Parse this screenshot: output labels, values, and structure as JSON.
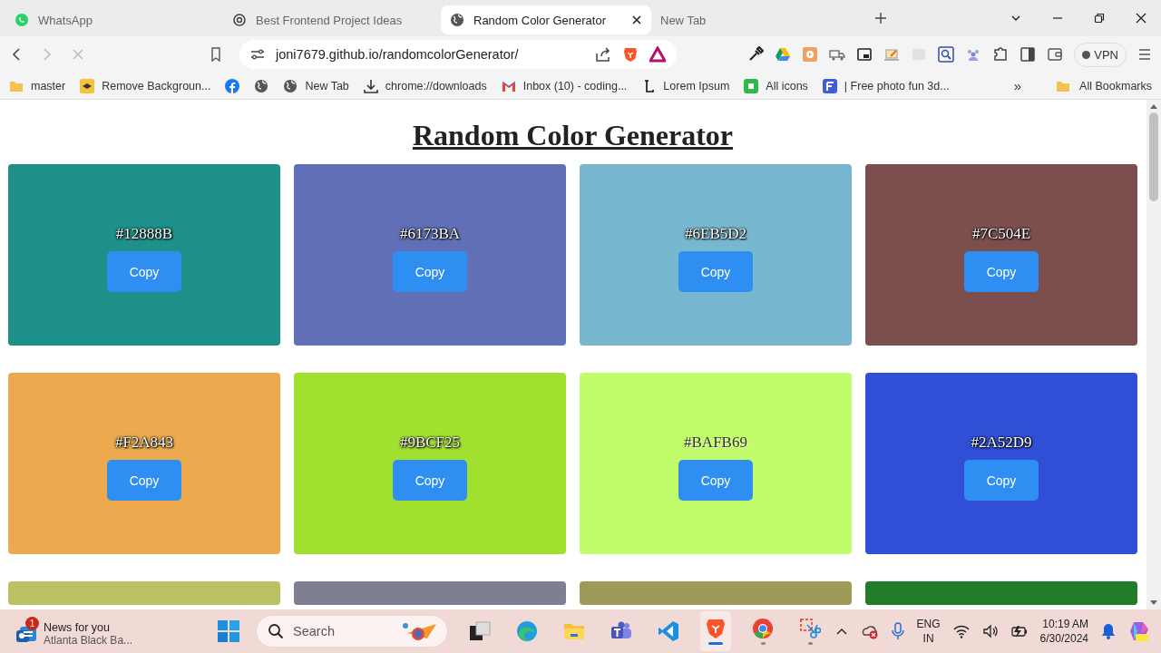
{
  "browser": {
    "tabs": [
      {
        "title": "WhatsApp",
        "selected": false
      },
      {
        "title": "Best Frontend Project Ideas",
        "selected": false
      },
      {
        "title": "Random Color Generator",
        "selected": true
      },
      {
        "title": "New Tab",
        "selected": false
      }
    ],
    "address": "joni7679.github.io/randomcolorGenerator/",
    "vpn_label": "VPN",
    "bookmarks": [
      {
        "kind": "labeled",
        "label": "master"
      },
      {
        "kind": "labeled",
        "label": "Remove Backgroun..."
      },
      {
        "kind": "icon"
      },
      {
        "kind": "icon"
      },
      {
        "kind": "labeled",
        "label": "New Tab"
      },
      {
        "kind": "labeled",
        "label": "chrome://downloads"
      },
      {
        "kind": "labeled",
        "label": "Inbox (10) - coding..."
      },
      {
        "kind": "labeled",
        "label": "Lorem Ipsum"
      },
      {
        "kind": "labeled",
        "label": "All icons"
      },
      {
        "kind": "labeled",
        "label": "| Free photo fun 3d..."
      }
    ],
    "overflow_label": "»",
    "all_bookmarks": "All Bookmarks"
  },
  "page": {
    "title": "Random Color Generator",
    "cards": [
      {
        "hex": "#12888B",
        "color": "#1d9189",
        "button": "Copy"
      },
      {
        "hex": "#6173BA",
        "color": "#6170b6",
        "button": "Copy"
      },
      {
        "hex": "#6EB5D2",
        "color": "#77b8d0",
        "button": "Copy"
      },
      {
        "hex": "#7C504E",
        "color": "#7c4f4e",
        "button": "Copy"
      },
      {
        "hex": "#F2A843",
        "color": "#eca94d",
        "button": "Copy"
      },
      {
        "hex": "#9BCF25",
        "color": "#a1e02f",
        "button": "Copy"
      },
      {
        "hex": "#BAFB69",
        "color": "#c1fc6a",
        "button": "Copy"
      },
      {
        "hex": "#2A52D9",
        "color": "#304fd6",
        "button": "Copy"
      },
      {
        "color": "#bbc263"
      },
      {
        "color": "#7e7f91"
      },
      {
        "color": "#9f9a58"
      },
      {
        "color": "#227c2a"
      }
    ]
  },
  "taskbar": {
    "news_title": "News for you",
    "news_subtitle": "Atlanta Black Ba...",
    "news_badge": "1",
    "search_placeholder": "Search",
    "language": "ENG",
    "region": "IN",
    "time": "10:19 AM",
    "date": "6/30/2024"
  }
}
